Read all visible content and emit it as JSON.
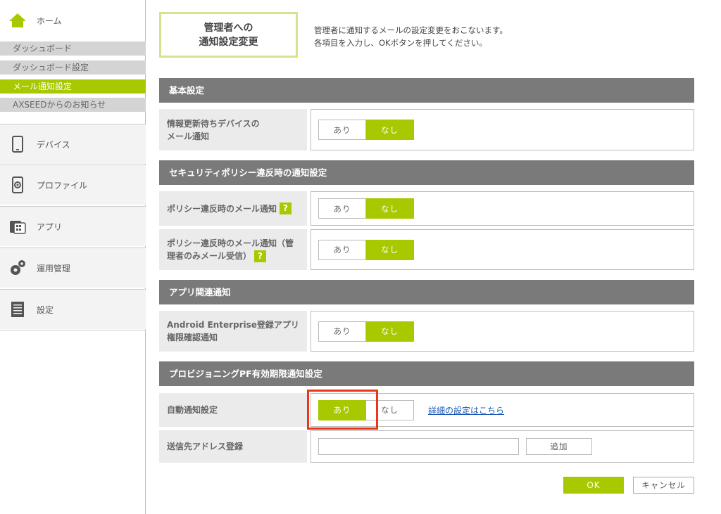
{
  "sidebar": {
    "home_label": "ホーム",
    "sub_items": [
      {
        "label": "ダッシュボード",
        "active": false
      },
      {
        "label": "ダッシュボード設定",
        "active": false
      },
      {
        "label": "メール通知設定",
        "active": true
      },
      {
        "label": "AXSEEDからのお知らせ",
        "active": false
      }
    ],
    "nav_items": [
      {
        "label": "デバイス",
        "icon": "device-icon"
      },
      {
        "label": "プロファイル",
        "icon": "profile-icon"
      },
      {
        "label": "アプリ",
        "icon": "app-icon"
      },
      {
        "label": "運用管理",
        "icon": "gear-icon"
      },
      {
        "label": "設定",
        "icon": "settings-icon"
      }
    ]
  },
  "header": {
    "title_line1": "管理者への",
    "title_line2": "通知設定変更",
    "desc_line1": "管理者に通知するメールの設定変更をおこないます。",
    "desc_line2": "各項目を入力し、OKボタンを押してください。"
  },
  "sections": {
    "basic": {
      "header": "基本設定",
      "row1_label_l1": "情報更新待ちデバイスの",
      "row1_label_l2": "メール通知",
      "row1_on": "あり",
      "row1_off": "なし"
    },
    "security": {
      "header": "セキュリティポリシー違反時の通知設定",
      "row1_label": "ポリシー違反時のメール通知",
      "row1_on": "あり",
      "row1_off": "なし",
      "row2_label_l1": "ポリシー違反時のメール通知（管",
      "row2_label_l2": "理者のみメール受信）",
      "row2_on": "あり",
      "row2_off": "なし",
      "help": "?"
    },
    "app": {
      "header": "アプリ関連通知",
      "row1_label_l1": "Android Enterprise登録アプリ",
      "row1_label_l2": "権限確認通知",
      "row1_on": "あり",
      "row1_off": "なし"
    },
    "provisioning": {
      "header": "プロビジョニングPF有効期限通知設定",
      "auto_label": "自動通知設定",
      "auto_on": "あり",
      "auto_off": "なし",
      "detail_link": "詳細の設定はこちら",
      "address_label": "送信先アドレス登録",
      "address_value": "",
      "add_button": "追加"
    }
  },
  "footer": {
    "ok": "OK",
    "cancel": "キャンセル"
  },
  "colors": {
    "accent": "#a8c900",
    "section_header": "#7a7a7a",
    "highlight": "#e8361a",
    "link": "#1a57b5"
  }
}
